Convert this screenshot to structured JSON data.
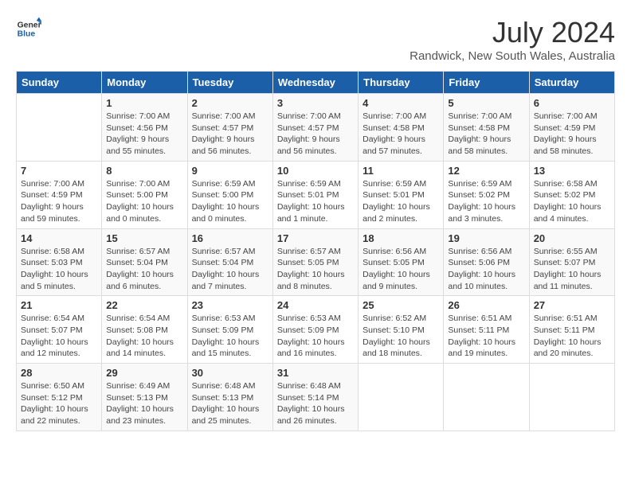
{
  "logo": {
    "text_general": "General",
    "text_blue": "Blue"
  },
  "title": {
    "month_year": "July 2024",
    "location": "Randwick, New South Wales, Australia"
  },
  "days_of_week": [
    "Sunday",
    "Monday",
    "Tuesday",
    "Wednesday",
    "Thursday",
    "Friday",
    "Saturday"
  ],
  "weeks": [
    [
      {
        "day": "",
        "info": ""
      },
      {
        "day": "1",
        "info": "Sunrise: 7:00 AM\nSunset: 4:56 PM\nDaylight: 9 hours and 55 minutes."
      },
      {
        "day": "2",
        "info": "Sunrise: 7:00 AM\nSunset: 4:57 PM\nDaylight: 9 hours and 56 minutes."
      },
      {
        "day": "3",
        "info": "Sunrise: 7:00 AM\nSunset: 4:57 PM\nDaylight: 9 hours and 56 minutes."
      },
      {
        "day": "4",
        "info": "Sunrise: 7:00 AM\nSunset: 4:58 PM\nDaylight: 9 hours and 57 minutes."
      },
      {
        "day": "5",
        "info": "Sunrise: 7:00 AM\nSunset: 4:58 PM\nDaylight: 9 hours and 58 minutes."
      },
      {
        "day": "6",
        "info": "Sunrise: 7:00 AM\nSunset: 4:59 PM\nDaylight: 9 hours and 58 minutes."
      }
    ],
    [
      {
        "day": "7",
        "info": "Sunrise: 7:00 AM\nSunset: 4:59 PM\nDaylight: 9 hours and 59 minutes."
      },
      {
        "day": "8",
        "info": "Sunrise: 7:00 AM\nSunset: 5:00 PM\nDaylight: 10 hours and 0 minutes."
      },
      {
        "day": "9",
        "info": "Sunrise: 6:59 AM\nSunset: 5:00 PM\nDaylight: 10 hours and 0 minutes."
      },
      {
        "day": "10",
        "info": "Sunrise: 6:59 AM\nSunset: 5:01 PM\nDaylight: 10 hours and 1 minute."
      },
      {
        "day": "11",
        "info": "Sunrise: 6:59 AM\nSunset: 5:01 PM\nDaylight: 10 hours and 2 minutes."
      },
      {
        "day": "12",
        "info": "Sunrise: 6:59 AM\nSunset: 5:02 PM\nDaylight: 10 hours and 3 minutes."
      },
      {
        "day": "13",
        "info": "Sunrise: 6:58 AM\nSunset: 5:02 PM\nDaylight: 10 hours and 4 minutes."
      }
    ],
    [
      {
        "day": "14",
        "info": "Sunrise: 6:58 AM\nSunset: 5:03 PM\nDaylight: 10 hours and 5 minutes."
      },
      {
        "day": "15",
        "info": "Sunrise: 6:57 AM\nSunset: 5:04 PM\nDaylight: 10 hours and 6 minutes."
      },
      {
        "day": "16",
        "info": "Sunrise: 6:57 AM\nSunset: 5:04 PM\nDaylight: 10 hours and 7 minutes."
      },
      {
        "day": "17",
        "info": "Sunrise: 6:57 AM\nSunset: 5:05 PM\nDaylight: 10 hours and 8 minutes."
      },
      {
        "day": "18",
        "info": "Sunrise: 6:56 AM\nSunset: 5:05 PM\nDaylight: 10 hours and 9 minutes."
      },
      {
        "day": "19",
        "info": "Sunrise: 6:56 AM\nSunset: 5:06 PM\nDaylight: 10 hours and 10 minutes."
      },
      {
        "day": "20",
        "info": "Sunrise: 6:55 AM\nSunset: 5:07 PM\nDaylight: 10 hours and 11 minutes."
      }
    ],
    [
      {
        "day": "21",
        "info": "Sunrise: 6:54 AM\nSunset: 5:07 PM\nDaylight: 10 hours and 12 minutes."
      },
      {
        "day": "22",
        "info": "Sunrise: 6:54 AM\nSunset: 5:08 PM\nDaylight: 10 hours and 14 minutes."
      },
      {
        "day": "23",
        "info": "Sunrise: 6:53 AM\nSunset: 5:09 PM\nDaylight: 10 hours and 15 minutes."
      },
      {
        "day": "24",
        "info": "Sunrise: 6:53 AM\nSunset: 5:09 PM\nDaylight: 10 hours and 16 minutes."
      },
      {
        "day": "25",
        "info": "Sunrise: 6:52 AM\nSunset: 5:10 PM\nDaylight: 10 hours and 18 minutes."
      },
      {
        "day": "26",
        "info": "Sunrise: 6:51 AM\nSunset: 5:11 PM\nDaylight: 10 hours and 19 minutes."
      },
      {
        "day": "27",
        "info": "Sunrise: 6:51 AM\nSunset: 5:11 PM\nDaylight: 10 hours and 20 minutes."
      }
    ],
    [
      {
        "day": "28",
        "info": "Sunrise: 6:50 AM\nSunset: 5:12 PM\nDaylight: 10 hours and 22 minutes."
      },
      {
        "day": "29",
        "info": "Sunrise: 6:49 AM\nSunset: 5:13 PM\nDaylight: 10 hours and 23 minutes."
      },
      {
        "day": "30",
        "info": "Sunrise: 6:48 AM\nSunset: 5:13 PM\nDaylight: 10 hours and 25 minutes."
      },
      {
        "day": "31",
        "info": "Sunrise: 6:48 AM\nSunset: 5:14 PM\nDaylight: 10 hours and 26 minutes."
      },
      {
        "day": "",
        "info": ""
      },
      {
        "day": "",
        "info": ""
      },
      {
        "day": "",
        "info": ""
      }
    ]
  ]
}
